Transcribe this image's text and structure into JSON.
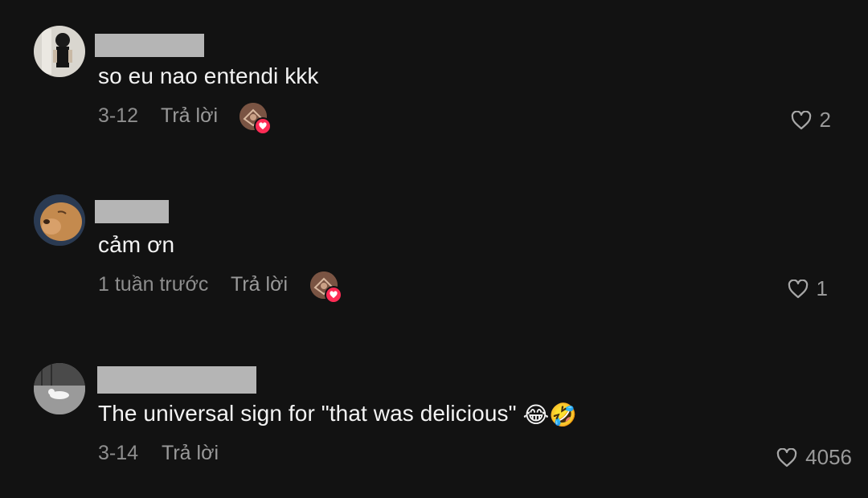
{
  "comments": [
    {
      "text": "so eu nao entendi kkk",
      "date": "3-12",
      "reply_label": "Trả lời",
      "like_count": "2",
      "liked_by_creator": true
    },
    {
      "text": "cảm ơn",
      "date": "1 tuần trước",
      "reply_label": "Trả lời",
      "like_count": "1",
      "liked_by_creator": true
    },
    {
      "text": "The universal sign for \"that was delicious\" ",
      "emojis": [
        "😂",
        "🤣"
      ],
      "date": "3-14",
      "reply_label": "Trả lời",
      "like_count": "4056",
      "liked_by_creator": false
    }
  ],
  "icons": {
    "like": "heart-outline-icon",
    "creator_like_badge": "heart-icon"
  },
  "colors": {
    "background": "#121212",
    "primary_text": "#f3f3f3",
    "secondary_text": "#8e8e8e",
    "badge": "#fe2c55",
    "redaction": "#b5b5b5"
  }
}
